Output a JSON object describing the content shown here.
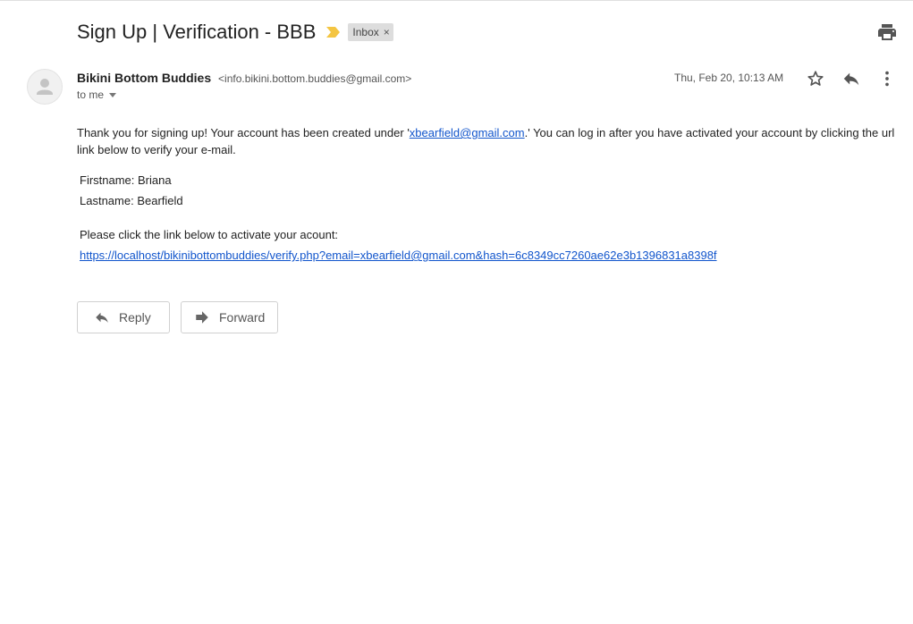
{
  "header": {
    "subject": "Sign Up | Verification - BBB",
    "label": "Inbox",
    "label_remove": "×"
  },
  "message": {
    "sender_name": "Bikini Bottom Buddies",
    "sender_email": "<info.bikini.bottom.buddies@gmail.com>",
    "to": "to me",
    "date": "Thu, Feb 20, 10:13 AM",
    "intro_before": "Thank you for signing up! Your account has been created under '",
    "intro_email": "xbearfield@gmail.com",
    "intro_after": ".' You can log in after you have activated your account by clicking the url link below to verify your e-mail.",
    "firstname": "Firstname: Briana",
    "lastname": "Lastname: Bearfield",
    "activate_prompt": "Please click the link below to activate your acount:",
    "verify_link": "https://localhost/bikinibottombuddies/verify.php?email=xbearfield@gmail.com&hash=6c8349cc7260ae62e3b1396831a8398f"
  },
  "actions": {
    "reply_label": "Reply",
    "forward_label": "Forward"
  },
  "icons": {
    "print": "printer-icon",
    "star": "star-icon",
    "reply": "reply-icon",
    "more": "more-vertical-icon",
    "important": "important-marker-icon",
    "avatar": "person-icon",
    "forward": "forward-icon"
  },
  "colors": {
    "link": "#1155cc",
    "important_marker": "#f4c542",
    "label_chip_bg": "#dddddd"
  }
}
